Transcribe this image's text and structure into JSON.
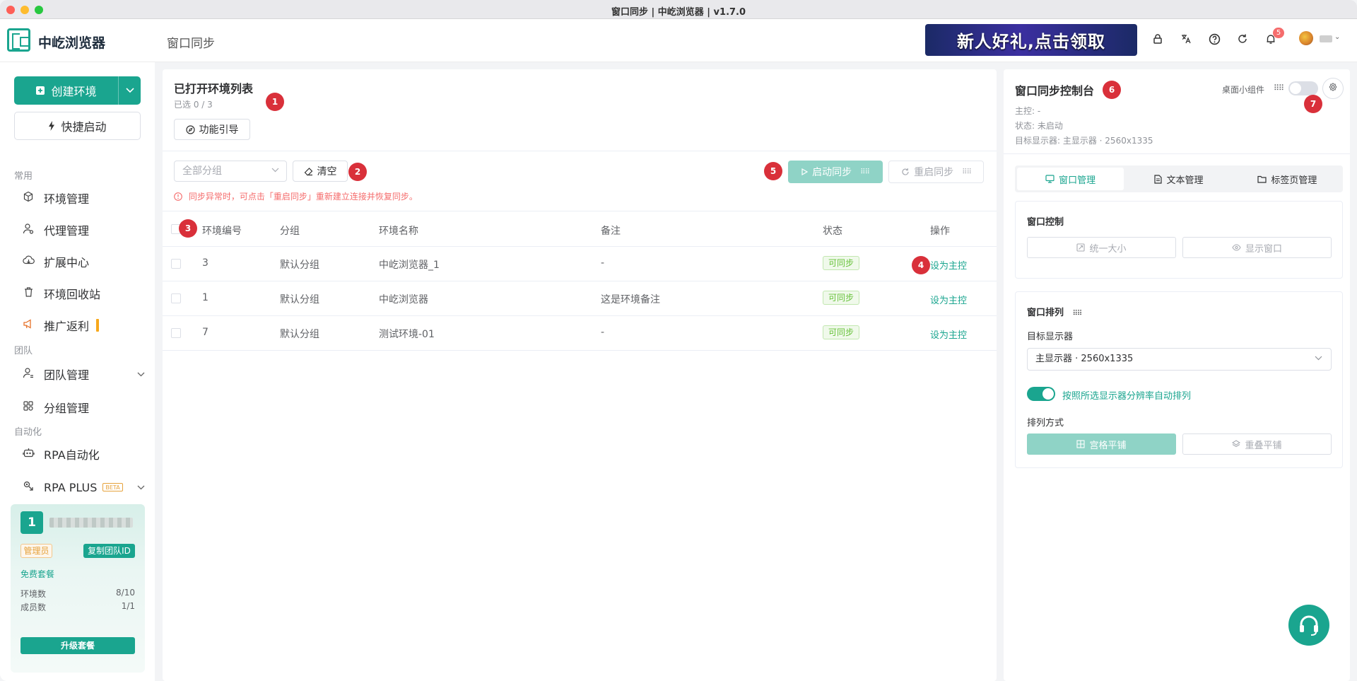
{
  "window": {
    "title": "窗口同步 | 中屹浏览器 | v1.7.0"
  },
  "topbar": {
    "brand": "中屹浏览器",
    "page_title": "窗口同步",
    "banner_text": "新人好礼,点击领取",
    "notification_count": "5",
    "icons": [
      "lock-icon",
      "translate-icon",
      "help-icon",
      "refresh-icon",
      "bell-icon"
    ]
  },
  "sidebar": {
    "create_label": "创建环境",
    "quick_label": "快捷启动",
    "sections": {
      "common": "常用",
      "team": "团队",
      "automation": "自动化"
    },
    "items": {
      "env": "环境管理",
      "proxy": "代理管理",
      "ext": "扩展中心",
      "recycle": "环境回收站",
      "promo": "推广返利",
      "team": "团队管理",
      "group": "分组管理",
      "rpa": "RPA自动化",
      "rpaplus": "RPA PLUS",
      "beta": "BETA"
    },
    "team_card": {
      "number": "1",
      "role": "管理员",
      "copy_id": "复制团队ID",
      "plan": "免费套餐",
      "env_label": "环境数",
      "env_value": "8/10",
      "member_label": "成员数",
      "member_value": "1/1",
      "upgrade": "升级套餐"
    }
  },
  "main": {
    "title": "已打开环境列表",
    "selected": "已选 0 / 3",
    "guide_label": "功能引导",
    "group_placeholder": "全部分组",
    "clear_label": "清空",
    "warning": "同步异常时，可点击「重启同步」重新建立连接并恢复同步。",
    "start_label": "启动同步",
    "restart_label": "重启同步",
    "columns": [
      "环境编号",
      "分组",
      "环境名称",
      "备注",
      "状态",
      "操作"
    ],
    "rows": [
      {
        "id": "3",
        "group": "默认分组",
        "name": "中屹浏览器_1",
        "note": "-",
        "status": "可同步",
        "action": "设为主控"
      },
      {
        "id": "1",
        "group": "默认分组",
        "name": "中屹浏览器",
        "note": "这是环境备注",
        "status": "可同步",
        "action": "设为主控"
      },
      {
        "id": "7",
        "group": "默认分组",
        "name": "测试环境-01",
        "note": "-",
        "status": "可同步",
        "action": "设为主控"
      }
    ]
  },
  "console": {
    "title": "窗口同步控制台",
    "master": "主控: -",
    "state": "状态: 未启动",
    "display": "目标显示器: 主显示器 · 2560x1335",
    "widget_label": "桌面小组件",
    "tabs": [
      "窗口管理",
      "文本管理",
      "标签页管理"
    ],
    "window_control": {
      "title": "窗口控制",
      "uniform_size": "统一大小",
      "show_window": "显示窗口"
    },
    "arrange": {
      "title": "窗口排列",
      "target_label": "目标显示器",
      "target_value": "主显示器 · 2560x1335",
      "auto_label": "按照所选显示器分辨率自动排列",
      "mode_label": "排列方式",
      "grid": "宫格平铺",
      "stack": "重叠平铺"
    }
  },
  "markers": [
    "1",
    "2",
    "3",
    "4",
    "5",
    "6",
    "7"
  ],
  "colors": {
    "accent": "#1aa58f",
    "marker": "#d9303a",
    "warning": "#f56c6c",
    "success": "#67c23a"
  }
}
